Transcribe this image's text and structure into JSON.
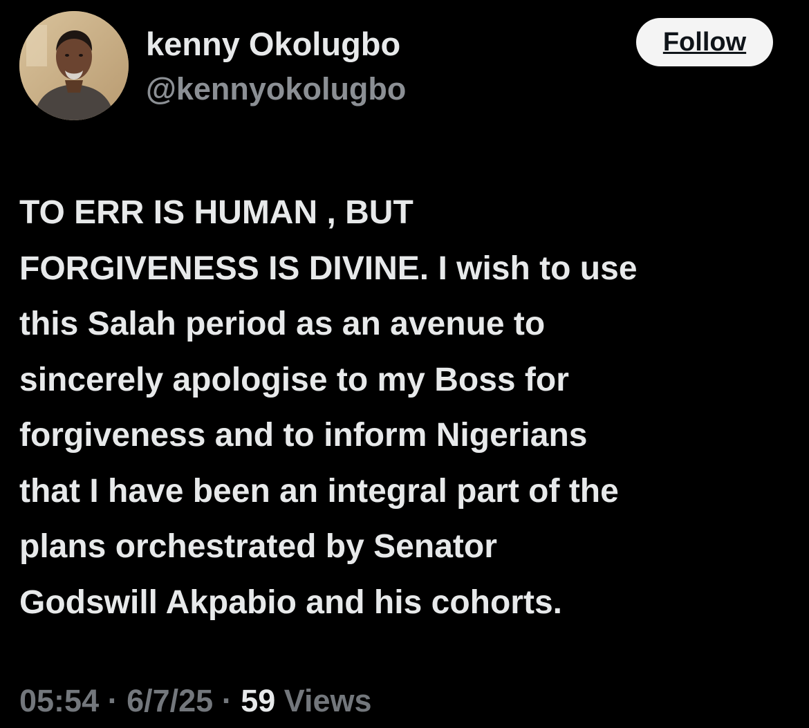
{
  "author": {
    "display_name": "kenny Okolugbo",
    "handle": "@kennyokolugbo"
  },
  "follow_button": {
    "label": "Follow"
  },
  "tweet": {
    "text": "TO ERR IS HUMAN , BUT\nFORGIVENESS IS DIVINE. I wish  to use\nthis Salah period  as an avenue to\nsincerely apologise to my Boss for\nforgiveness and to inform  Nigerians\nthat I have been an integral part of the\nplans  orchestrated  by Senator\nGodswill Akpabio  and his cohorts."
  },
  "meta": {
    "time": "05:54",
    "separator": " · ",
    "date": "6/7/25",
    "views_count": "59",
    "views_label": " Views"
  },
  "colors": {
    "background": "#000000",
    "primary_text": "#e7e9ea",
    "secondary_text": "#8b8f94",
    "follow_bg": "#f4f4f4"
  }
}
